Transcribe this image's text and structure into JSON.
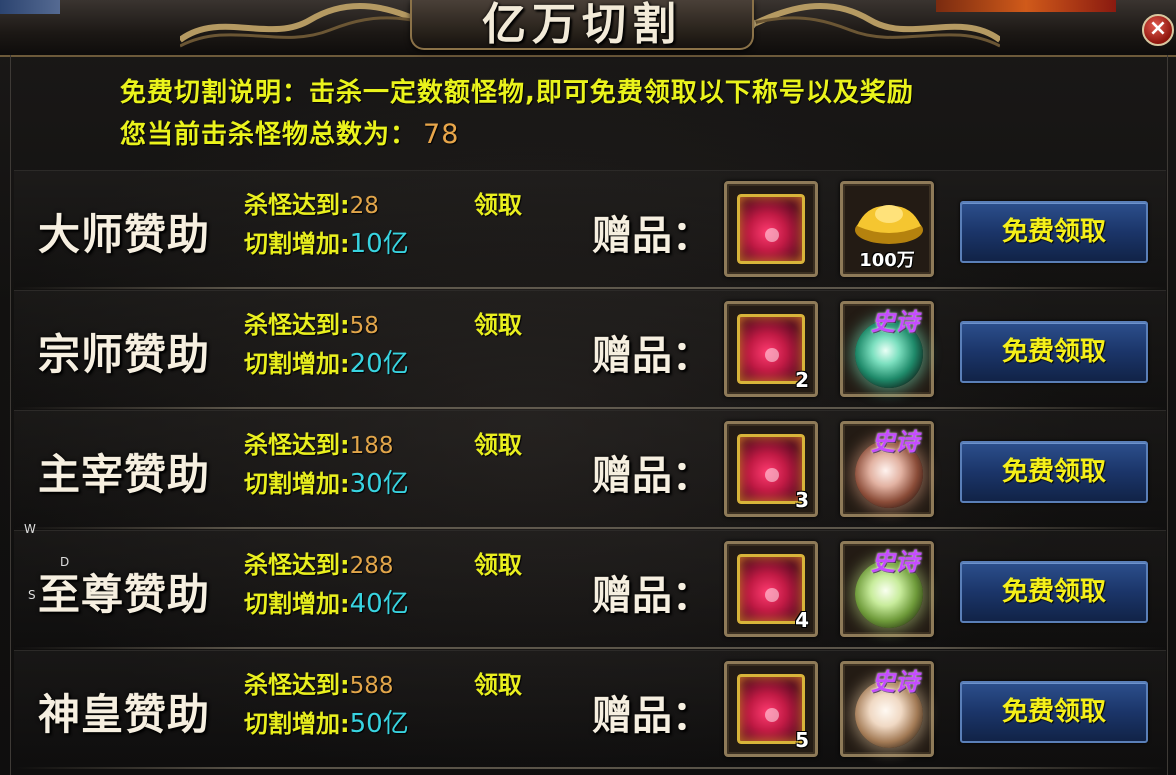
{
  "window": {
    "title": "亿万切割",
    "close_label": "×"
  },
  "description": {
    "line1": "免费切割说明：击杀一定数额怪物,即可免费领取以下称号以及奖励",
    "line2_label": "您当前击杀怪物总数为：",
    "kill_count": "78"
  },
  "labels": {
    "kill_prefix": "杀怪达到:",
    "cut_prefix": "切割增加:",
    "claim_text": "领取",
    "gift_label": "赠品：",
    "button": "免费领取",
    "epic": "史诗"
  },
  "rows": [
    {
      "name": "大师赞助",
      "kill": "28",
      "cut": "10亿",
      "bag_qty": "",
      "second_reward": "ingot",
      "second_qty": "100万"
    },
    {
      "name": "宗师赞助",
      "kill": "58",
      "cut": "20亿",
      "bag_qty": "2",
      "second_reward": "epic-orb",
      "second_qty": ""
    },
    {
      "name": "主宰赞助",
      "kill": "188",
      "cut": "30亿",
      "bag_qty": "3",
      "second_reward": "epic-orb",
      "second_qty": ""
    },
    {
      "name": "至尊赞助",
      "kill": "288",
      "cut": "40亿",
      "bag_qty": "4",
      "second_reward": "epic-orb",
      "second_qty": ""
    },
    {
      "name": "神皇赞助",
      "kill": "588",
      "cut": "50亿",
      "bag_qty": "5",
      "second_reward": "epic-orb",
      "second_qty": ""
    }
  ],
  "overlay_hints": [
    "W",
    "D",
    "S"
  ],
  "colors": {
    "highlight_yellow": "#e9ef1e",
    "kill_value": "#e1a54a",
    "cut_value": "#38d3e0",
    "button_blue": "#1b3569",
    "epic_purple": "#c64cff"
  }
}
